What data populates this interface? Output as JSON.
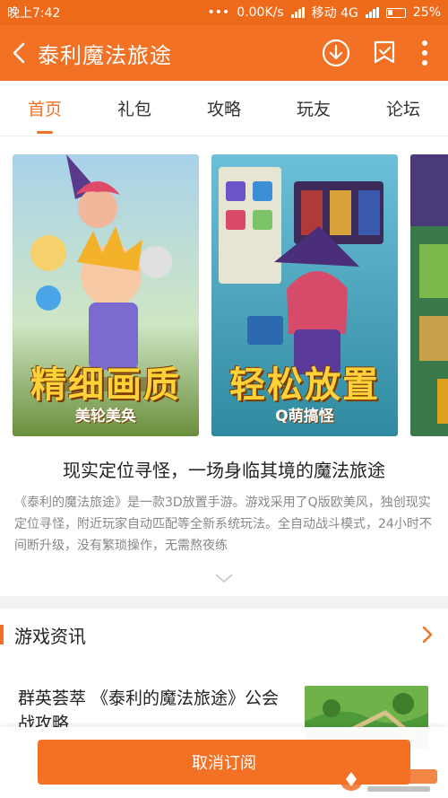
{
  "status_bar": {
    "time": "晚上7:42",
    "dots": "•••",
    "network_speed": "0.00K/s",
    "carrier": "移动 4G",
    "battery": "25%"
  },
  "app_bar": {
    "title": "泰利魔法旅途",
    "icons": [
      "back-arrow-icon",
      "download-icon",
      "bookmark-icon",
      "more-icon"
    ]
  },
  "tabs": [
    {
      "label": "首页",
      "active": true
    },
    {
      "label": "礼包",
      "active": false
    },
    {
      "label": "攻略",
      "active": false
    },
    {
      "label": "玩友",
      "active": false
    },
    {
      "label": "论坛",
      "active": false
    }
  ],
  "screenshots": [
    {
      "caption": "精细画质",
      "subcaption": "美轮美奂"
    },
    {
      "caption": "轻松放置",
      "subcaption": "Q萌搞怪"
    }
  ],
  "intro": {
    "headline": "现实定位寻怪，一场身临其境的魔法旅途",
    "description": "《泰利的魔法旅途》是一款3D放置手游。游戏采用了Q版欧美风，独创现实定位寻怪，附近玩家自动匹配等全新系统玩法。全自动战斗模式，24小时不间断升级，没有繁琐操作，无需熬夜练"
  },
  "news_section": {
    "title": "游戏资讯",
    "items": [
      {
        "title": "群英荟萃 《泰利的魔法旅途》公会战攻略"
      }
    ]
  },
  "bottom": {
    "unsubscribe_label": "取消订阅"
  },
  "colors": {
    "accent": "#f27124",
    "status_bar": "#ee6a1b"
  }
}
